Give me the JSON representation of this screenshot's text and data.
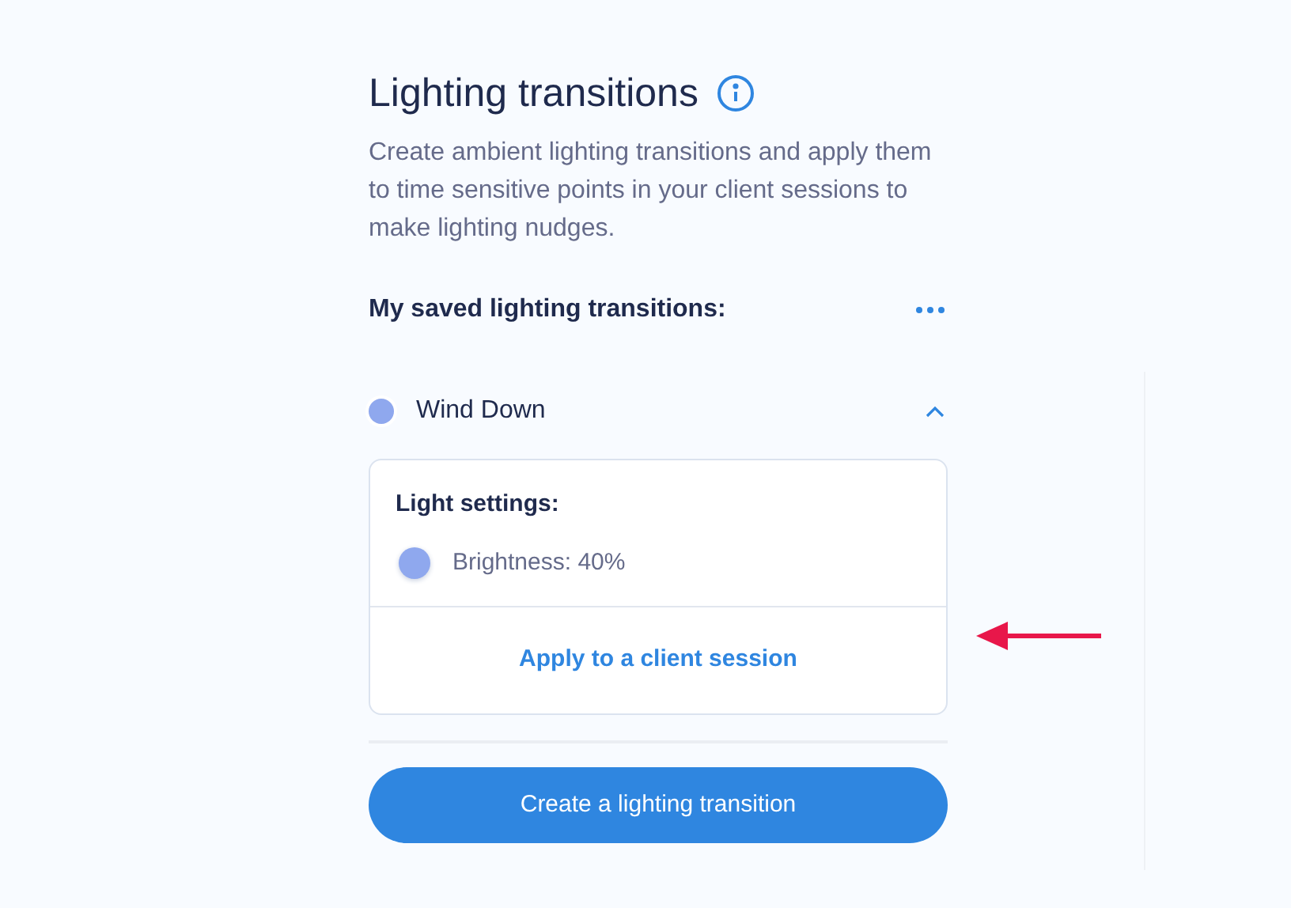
{
  "title": "Lighting transitions",
  "description": "Create ambient lighting transitions and apply them to time sensitive points in your client sessions to make lighting nudges.",
  "saved_heading": "My saved lighting transitions:",
  "transitions": [
    {
      "name": "Wind Down",
      "color": "#8fa8ee",
      "expanded": true,
      "settings_title": "Light settings:",
      "settings": [
        {
          "label": "Brightness: 40%",
          "color": "#8fa8ee"
        }
      ],
      "apply_link": "Apply to a client session"
    }
  ],
  "create_button": "Create a lighting transition"
}
